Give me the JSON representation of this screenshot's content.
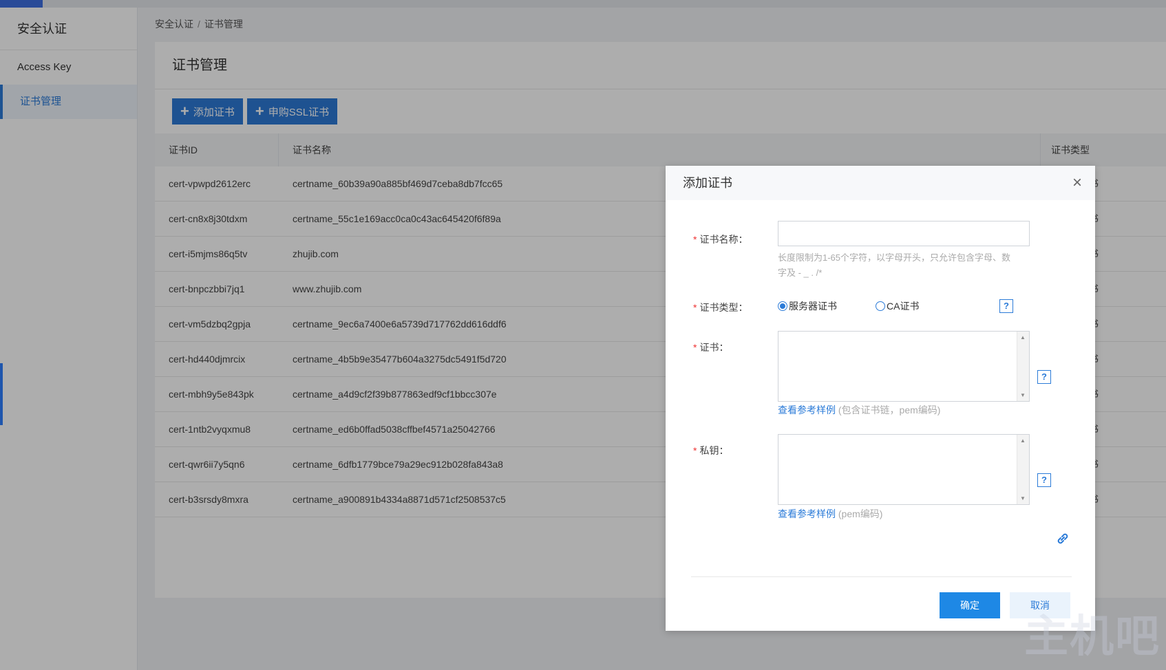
{
  "sidebar": {
    "title": "安全认证",
    "items": [
      {
        "label": "Access Key",
        "active": false
      },
      {
        "label": "证书管理",
        "active": true
      }
    ]
  },
  "breadcrumb": {
    "parent": "安全认证",
    "separator": "/",
    "current": "证书管理"
  },
  "panel": {
    "title": "证书管理",
    "buttons": {
      "add_cert": "添加证书",
      "buy_ssl": "申购SSL证书"
    }
  },
  "table": {
    "headers": {
      "id": "证书ID",
      "name": "证书名称",
      "type": "证书类型"
    },
    "rows": [
      {
        "id": "cert-vpwpd2612erc",
        "name": "certname_60b39a90a885bf469d7ceba8db7fcc65",
        "type": "服务器证书"
      },
      {
        "id": "cert-cn8x8j30tdxm",
        "name": "certname_55c1e169acc0ca0c43ac645420f6f89a",
        "type": "服务器证书"
      },
      {
        "id": "cert-i5mjms86q5tv",
        "name": "zhujib.com",
        "type": "服务器证书"
      },
      {
        "id": "cert-bnpczbbi7jq1",
        "name": "www.zhujib.com",
        "type": "服务器证书"
      },
      {
        "id": "cert-vm5dzbq2gpja",
        "name": "certname_9ec6a7400e6a5739d717762dd616ddf6",
        "type": "服务器证书"
      },
      {
        "id": "cert-hd440djmrcix",
        "name": "certname_4b5b9e35477b604a3275dc5491f5d720",
        "type": "服务器证书"
      },
      {
        "id": "cert-mbh9y5e843pk",
        "name": "certname_a4d9cf2f39b877863edf9cf1bbcc307e",
        "type": "服务器证书"
      },
      {
        "id": "cert-1ntb2vyqxmu8",
        "name": "certname_ed6b0ffad5038cffbef4571a25042766",
        "type": "服务器证书"
      },
      {
        "id": "cert-qwr6ii7y5qn6",
        "name": "certname_6dfb1779bce79a29ec912b028fa843a8",
        "type": "服务器证书"
      },
      {
        "id": "cert-b3srsdy8mxra",
        "name": "certname_a900891b4334a8871d571cf2508537c5",
        "type": "服务器证书"
      }
    ]
  },
  "modal": {
    "title": "添加证书",
    "close_icon": "×",
    "required_mark": "*",
    "fields": {
      "name": {
        "label": "证书名称：",
        "value": "",
        "hint": "长度限制为1-65个字符，以字母开头，只允许包含字母、数字及 - _ . /*"
      },
      "type": {
        "label": "证书类型：",
        "options": [
          "服务器证书",
          "CA证书"
        ],
        "selected": "服务器证书"
      },
      "cert": {
        "label": "证书：",
        "value": "",
        "link": "查看参考样例",
        "link_note": "(包含证书链，pem编码)"
      },
      "key": {
        "label": "私钥：",
        "value": "",
        "link": "查看参考样例",
        "link_note": "(pem编码)"
      }
    },
    "help_glyph": "?",
    "buttons": {
      "ok": "确定",
      "cancel": "取消"
    }
  },
  "watermark": "主机吧",
  "colors": {
    "primary": "#2b7bd8",
    "button_dark": "#2d7ad6",
    "ok_button": "#1e88e5",
    "required": "#e33333"
  },
  "icons": {
    "add": "plus-icon",
    "close": "close-icon",
    "help": "help-icon",
    "link": "link-icon"
  }
}
